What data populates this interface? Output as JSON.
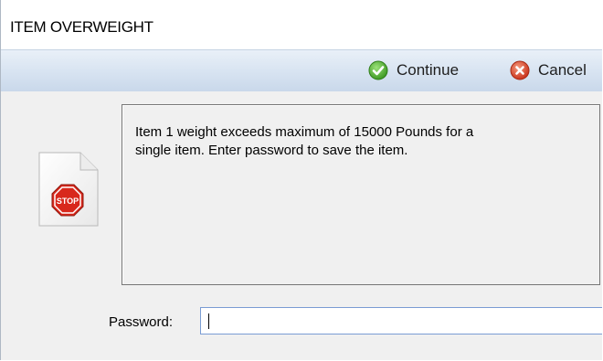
{
  "window": {
    "title": "ITEM OVERWEIGHT"
  },
  "toolbar": {
    "continue_label": "Continue",
    "cancel_label": "Cancel",
    "continue_icon": "check-circle-icon",
    "cancel_icon": "close-circle-icon",
    "colors": {
      "continue": "#4caf32",
      "cancel": "#d9412a"
    }
  },
  "message": {
    "icon": "stop-sign-icon",
    "icon_label": "STOP",
    "text": "Item 1 weight exceeds maximum of 15000 Pounds for a\nsingle item. Enter password to save the item."
  },
  "password": {
    "label": "Password:",
    "value": ""
  }
}
